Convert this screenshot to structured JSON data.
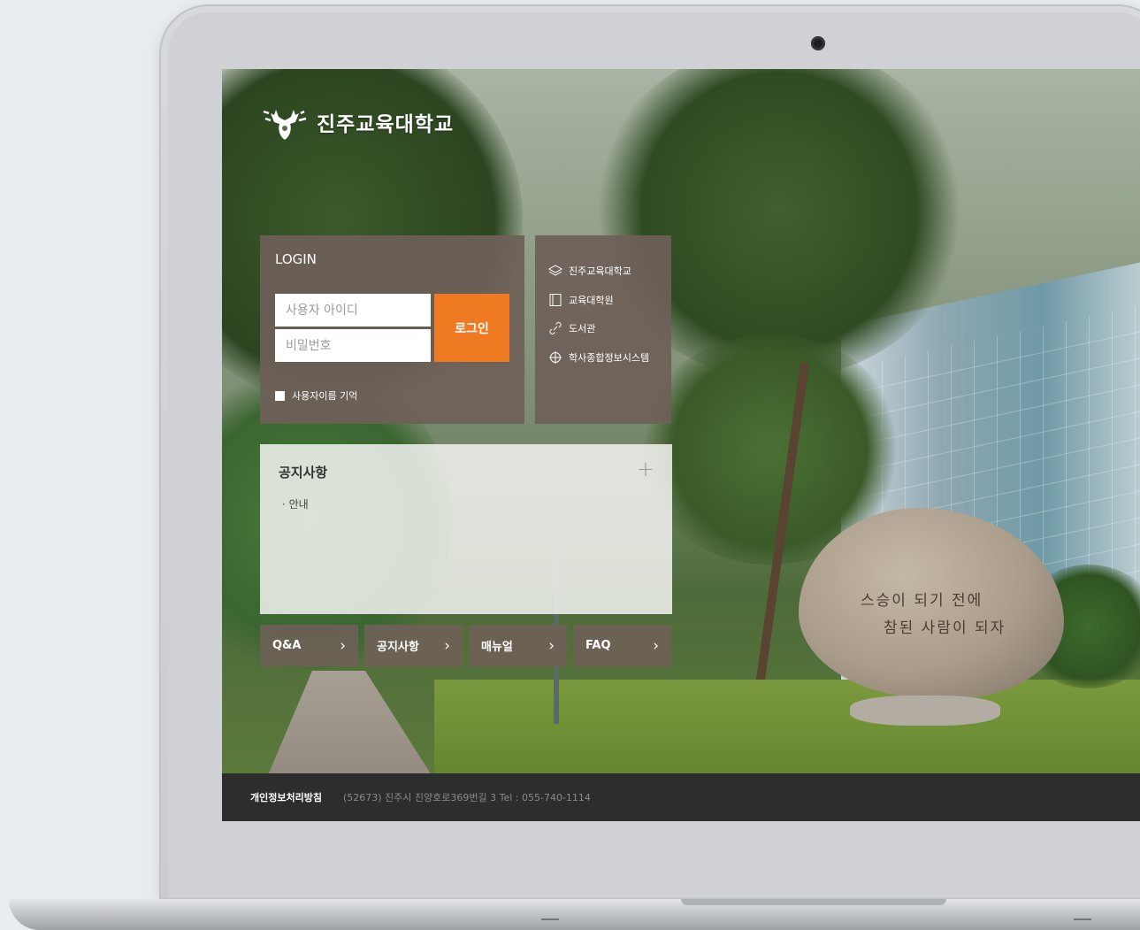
{
  "logo": {
    "text": "진주교육대학교"
  },
  "login": {
    "title": "LOGIN",
    "username_placeholder": "사용자 아이디",
    "password_placeholder": "비밀번호",
    "button_label": "로그인",
    "remember_label": "사용자이름 기억"
  },
  "links": [
    {
      "icon": "layers-icon",
      "label": "진주교육대학교"
    },
    {
      "icon": "document-icon",
      "label": "교육대학원"
    },
    {
      "icon": "link-icon",
      "label": "도서관"
    },
    {
      "icon": "crosshair-icon",
      "label": "학사종합정보시스템"
    }
  ],
  "notice": {
    "title": "공지사항",
    "more_icon": "plus-icon",
    "items": [
      "· 안내"
    ]
  },
  "quick_links": [
    {
      "label": "Q&A"
    },
    {
      "label": "공지사항"
    },
    {
      "label": "매뉴얼"
    },
    {
      "label": "FAQ"
    }
  ],
  "footer": {
    "policy": "개인정보처리방침",
    "address": "(52673) 진주시 진양호로369번길 3   Tel : 055-740-1114"
  },
  "background": {
    "rock_text_line1": "스승이 되기 전에",
    "rock_text_line2": "참된 사람이 되자"
  },
  "colors": {
    "accent": "#ef7a22",
    "panel": "#6e6058",
    "footer": "#2d2d2d"
  }
}
